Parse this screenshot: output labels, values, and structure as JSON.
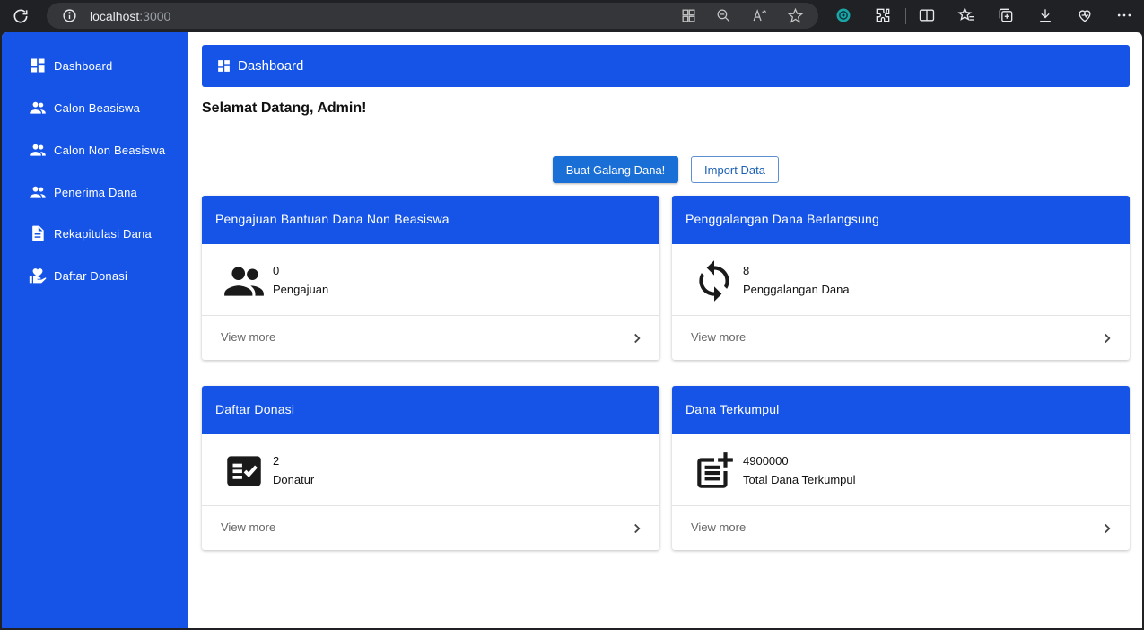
{
  "browser": {
    "url_host": "localhost",
    "url_port": ":3000"
  },
  "sidebar": {
    "items": [
      {
        "label": "Dashboard",
        "icon": "dashboard-icon"
      },
      {
        "label": "Calon Beasiswa",
        "icon": "people-icon"
      },
      {
        "label": "Calon Non Beasiswa",
        "icon": "people-icon"
      },
      {
        "label": "Penerima Dana",
        "icon": "people-icon"
      },
      {
        "label": "Rekapitulasi Dana",
        "icon": "document-icon"
      },
      {
        "label": "Daftar Donasi",
        "icon": "volunteer-icon"
      }
    ]
  },
  "header": {
    "title": "Dashboard",
    "icon": "dashboard-icon"
  },
  "welcome": "Selamat Datang, Admin!",
  "actions": {
    "primary_label": "Buat Galang Dana!",
    "secondary_label": "Import Data"
  },
  "cards": [
    {
      "title": "Pengajuan Bantuan Dana Non Beasiswa",
      "value": "0",
      "unit": "Pengajuan",
      "icon": "people-icon",
      "link": "View more"
    },
    {
      "title": "Penggalangan Dana Berlangsung",
      "value": "8",
      "unit": "Penggalangan Dana",
      "icon": "sync-icon",
      "link": "View more"
    },
    {
      "title": "Daftar Donasi",
      "value": "2",
      "unit": "Donatur",
      "icon": "fact-check-icon",
      "link": "View more"
    },
    {
      "title": "Dana Terkumpul",
      "value": "4900000",
      "unit": "Total Dana Terkumpul",
      "icon": "post-add-icon",
      "link": "View more"
    }
  ],
  "colors": {
    "brand_blue": "#1554e6",
    "button_blue": "#1a6fd6",
    "browser_dark": "#202124"
  }
}
